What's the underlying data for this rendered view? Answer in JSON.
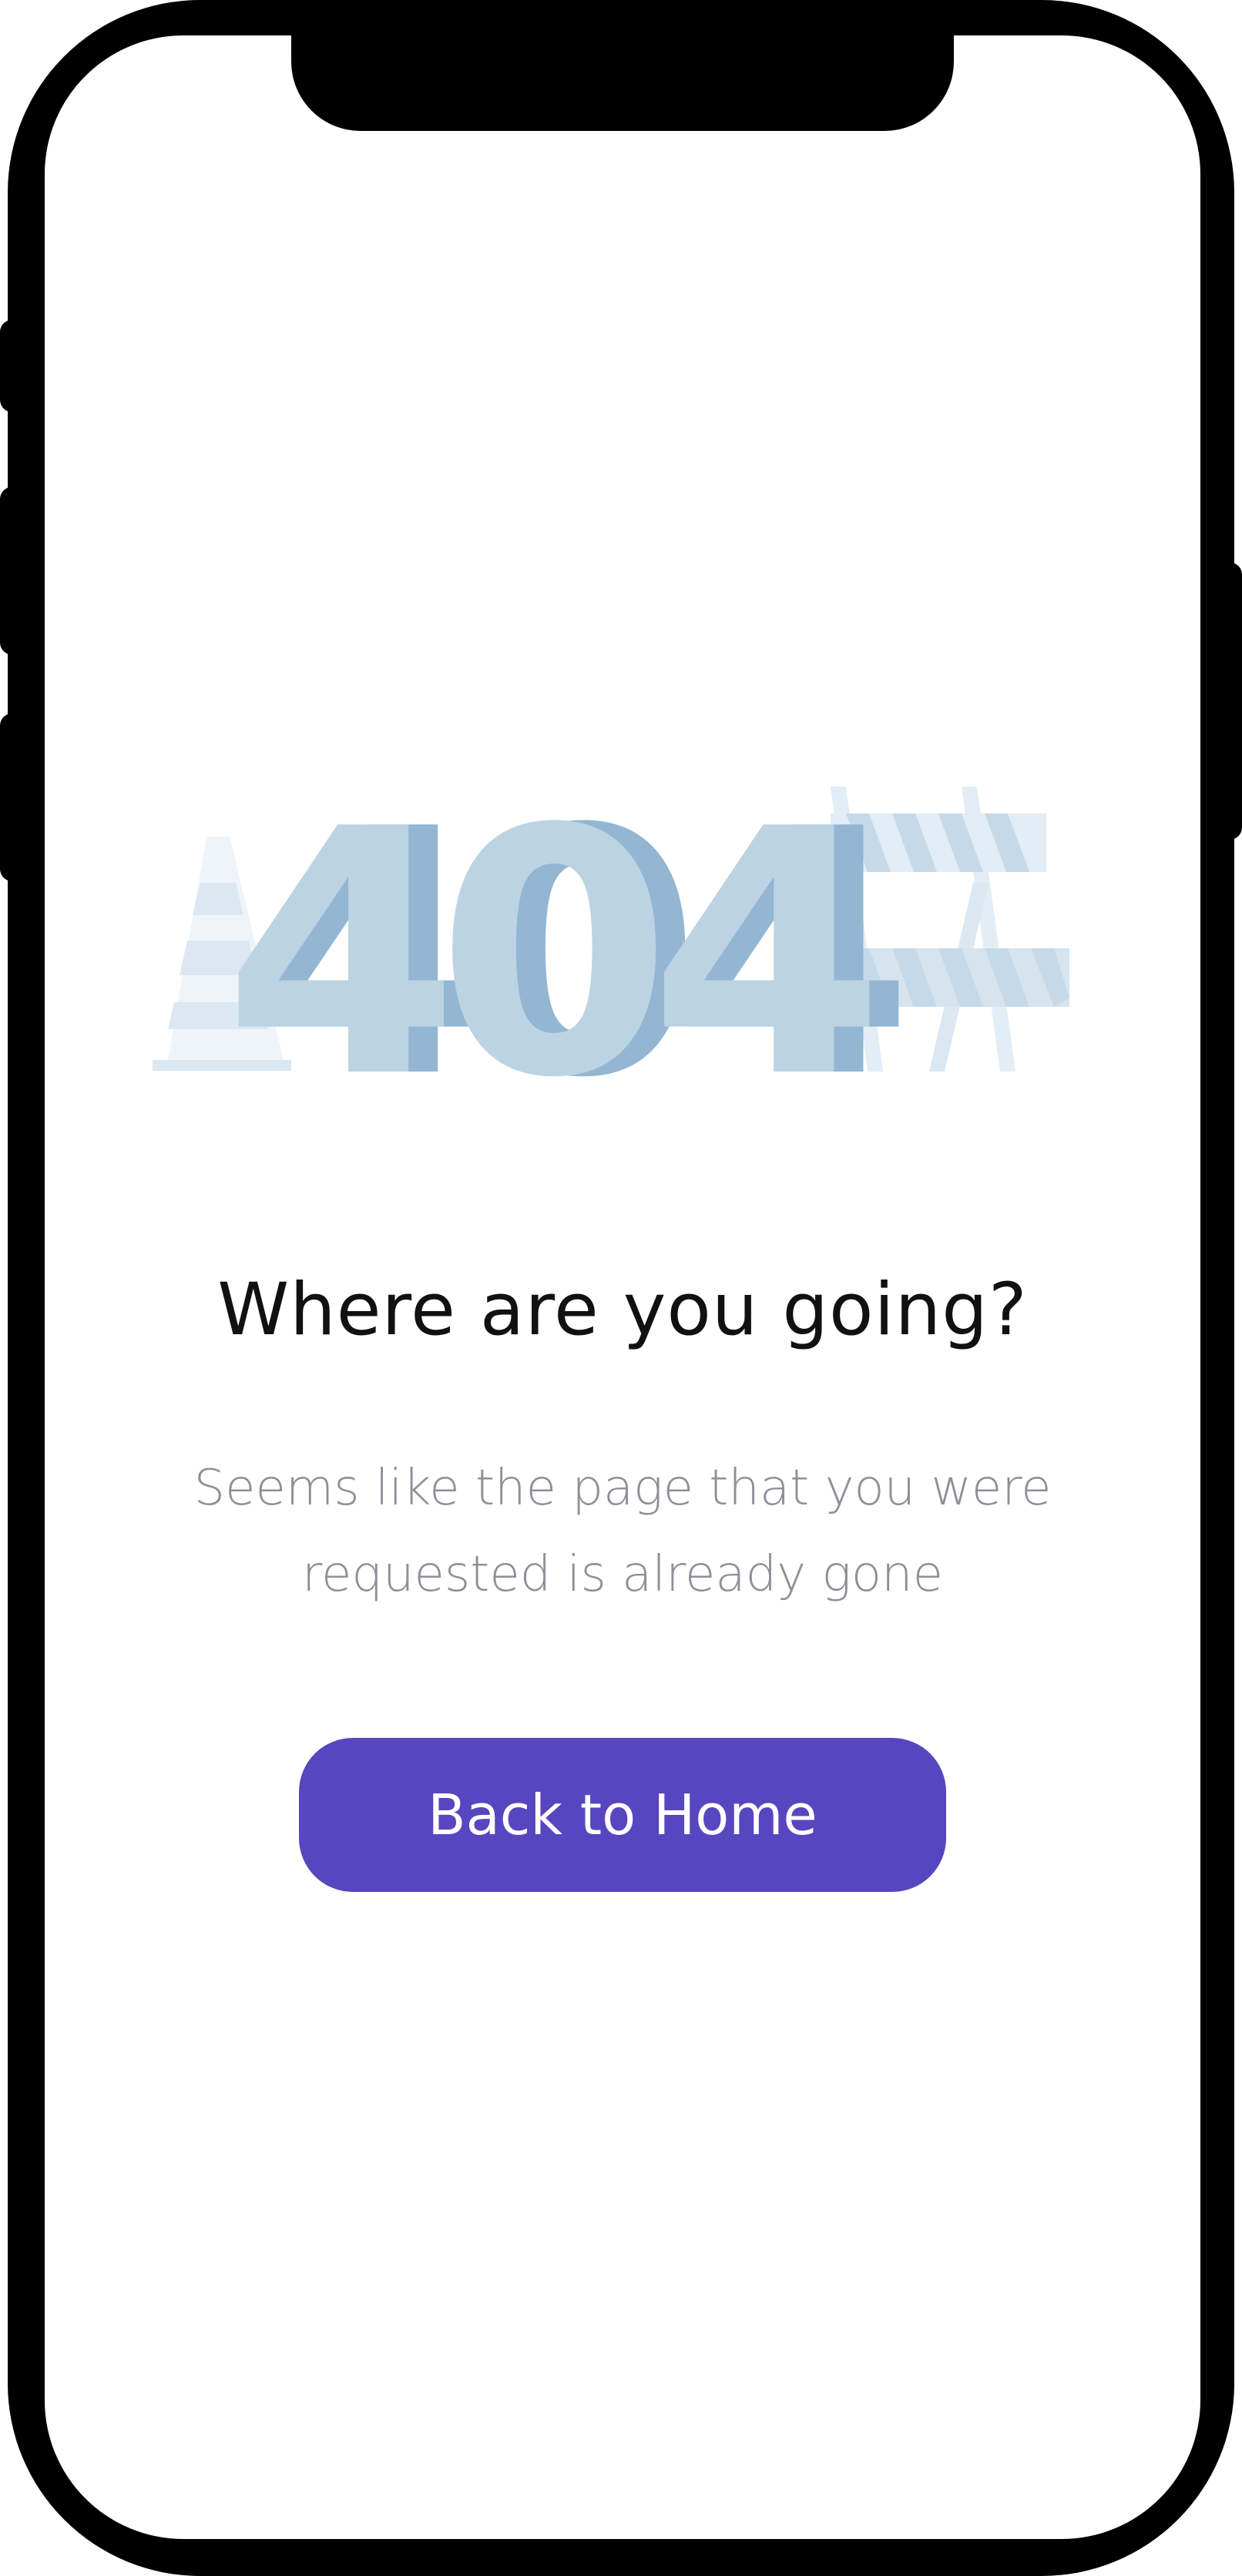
{
  "illustration": {
    "code_text": "404",
    "icons": [
      "traffic-cone-icon",
      "road-barrier-icon"
    ],
    "colors": {
      "digit_front": "#bcd3e3",
      "digit_shadow": "#93b6d2",
      "barrier": "#d5e4ef",
      "cone": "#e8f0f6"
    }
  },
  "content": {
    "headline": "Where are you going?",
    "subtext_line1": "Seems like the page that you were",
    "subtext_line2": "requested is already gone"
  },
  "actions": {
    "back_home_label": "Back to Home",
    "accent_color": "#5746bf"
  }
}
